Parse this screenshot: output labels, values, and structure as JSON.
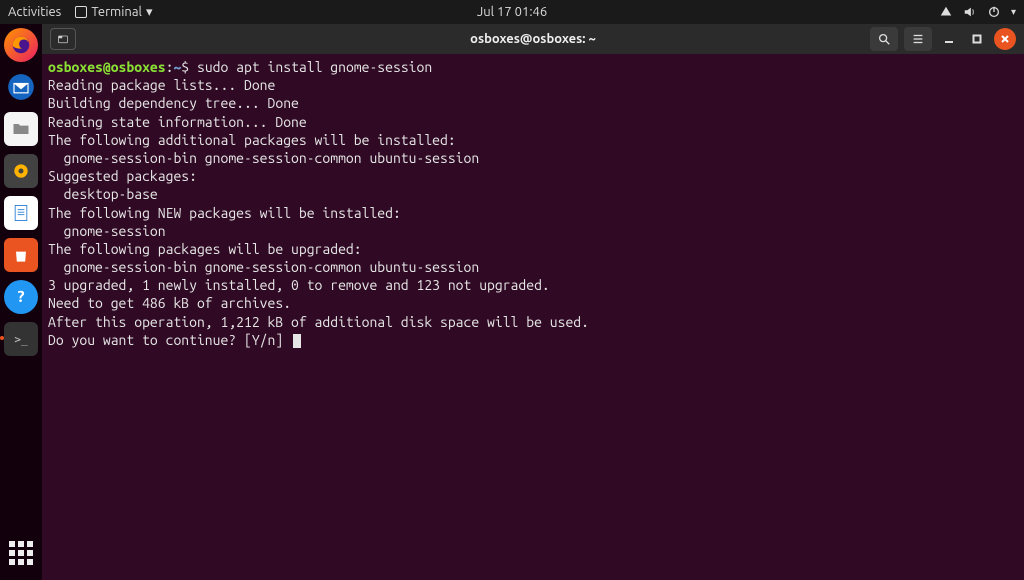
{
  "topbar": {
    "activities": "Activities",
    "appmenu": "Terminal",
    "clock": "Jul 17  01:46"
  },
  "window": {
    "title": "osboxes@osboxes: ~"
  },
  "prompt": {
    "userhost": "osboxes@osboxes",
    "sep1": ":",
    "path": "~",
    "sep2": "$ ",
    "command": "sudo apt install gnome-session"
  },
  "output": {
    "l0": "Reading package lists... Done",
    "l1": "Building dependency tree... Done",
    "l2": "Reading state information... Done",
    "l3": "The following additional packages will be installed:",
    "l4": "  gnome-session-bin gnome-session-common ubuntu-session",
    "l5": "Suggested packages:",
    "l6": "  desktop-base",
    "l7": "The following NEW packages will be installed:",
    "l8": "  gnome-session",
    "l9": "The following packages will be upgraded:",
    "l10": "  gnome-session-bin gnome-session-common ubuntu-session",
    "l11": "3 upgraded, 1 newly installed, 0 to remove and 123 not upgraded.",
    "l12": "Need to get 486 kB of archives.",
    "l13": "After this operation, 1,212 kB of additional disk space will be used.",
    "l14": "Do you want to continue? [Y/n] "
  }
}
